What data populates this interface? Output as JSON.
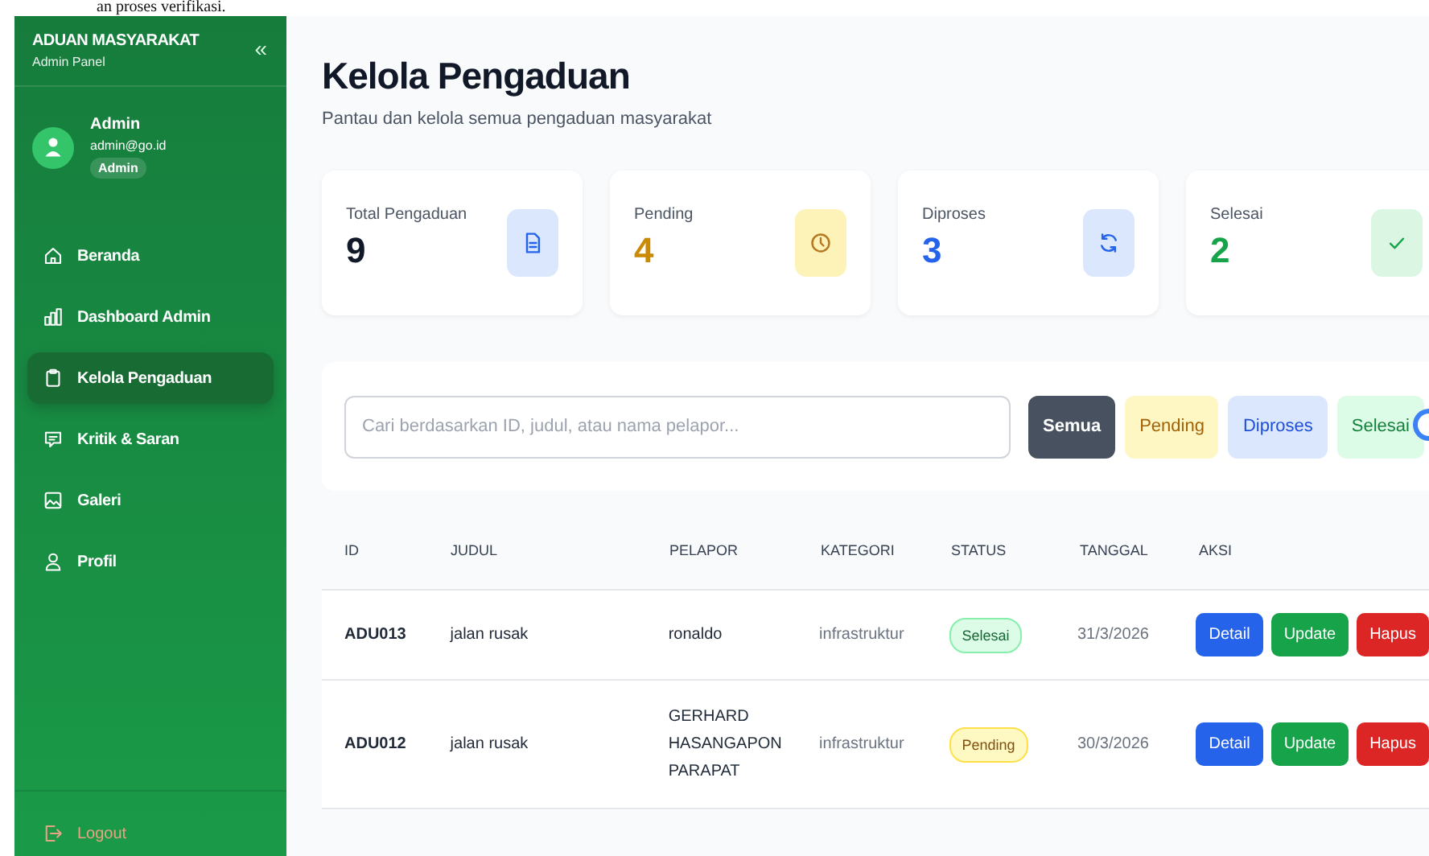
{
  "page_top_text": "an proses verifikasi.",
  "sidebar": {
    "brand": "ADUAN MASYARAKAT",
    "subtitle": "Admin Panel",
    "collapse": "«",
    "user": {
      "name": "Admin",
      "email": "admin@go.id",
      "role": "Admin"
    },
    "items": [
      {
        "label": "Beranda",
        "kind": "home",
        "selected": false
      },
      {
        "label": "Dashboard Admin",
        "kind": "dashboard",
        "selected": false
      },
      {
        "label": "Kelola Pengaduan",
        "kind": "complaints",
        "selected": true
      },
      {
        "label": "Kritik & Saran",
        "kind": "feedback",
        "selected": false
      },
      {
        "label": "Galeri",
        "kind": "gallery",
        "selected": false
      },
      {
        "label": "Profil",
        "kind": "profile",
        "selected": false
      }
    ],
    "logout": "Logout"
  },
  "header": {
    "title": "Kelola Pengaduan",
    "subtitle": "Pantau dan kelola semua pengaduan masyarakat"
  },
  "stats": [
    {
      "label": "Total Pengaduan",
      "value": "9",
      "kind": "total"
    },
    {
      "label": "Pending",
      "value": "4",
      "kind": "pending"
    },
    {
      "label": "Diproses",
      "value": "3",
      "kind": "diproses"
    },
    {
      "label": "Selesai",
      "value": "2",
      "kind": "selesai"
    }
  ],
  "filter": {
    "placeholder": "Cari berdasarkan ID, judul, atau nama pelapor...",
    "buttons": [
      {
        "label": "Semua",
        "kind": "all",
        "selected": true
      },
      {
        "label": "Pending",
        "kind": "pending",
        "selected": false
      },
      {
        "label": "Diproses",
        "kind": "diproses",
        "selected": false
      },
      {
        "label": "Selesai",
        "kind": "selesai",
        "selected": false
      }
    ]
  },
  "table": {
    "columns": [
      "ID",
      "JUDUL",
      "PELAPOR",
      "KATEGORI",
      "STATUS",
      "TANGGAL",
      "AKSI"
    ],
    "rows": [
      {
        "id": "ADU013",
        "judul": "jalan rusak",
        "pelapor": "ronaldo",
        "kategori": "infrastruktur",
        "status": {
          "label": "Selesai",
          "kind": "selesai"
        },
        "tanggal": "31/3/2026",
        "actions": [
          {
            "label": "Detail",
            "kind": "detail"
          },
          {
            "label": "Update",
            "kind": "update"
          },
          {
            "label": "Hapus",
            "kind": "hapus"
          }
        ]
      },
      {
        "id": "ADU012",
        "judul": "jalan rusak",
        "pelapor": "GERHARD HASANGAPON PARAPAT",
        "kategori": "infrastruktur",
        "status": {
          "label": "Pending",
          "kind": "pending"
        },
        "tanggal": "30/3/2026",
        "actions": [
          {
            "label": "Detail",
            "kind": "detail"
          },
          {
            "label": "Update",
            "kind": "update"
          },
          {
            "label": "Hapus",
            "kind": "hapus"
          }
        ]
      }
    ]
  }
}
